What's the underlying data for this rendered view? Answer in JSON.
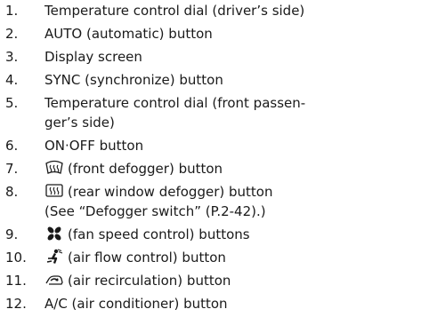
{
  "items": [
    {
      "num": "1.",
      "text": "Temperature control dial (driver’s side)"
    },
    {
      "num": "2.",
      "text": "AUTO (automatic) button"
    },
    {
      "num": "3.",
      "text": "Display screen"
    },
    {
      "num": "4.",
      "text": "SYNC (synchronize) button"
    },
    {
      "num": "5.",
      "text": "Temperature control dial (front passen-",
      "text2": "ger’s side)"
    },
    {
      "num": "6.",
      "text": "ON·OFF button"
    },
    {
      "num": "7.",
      "text": "(front defogger) button",
      "icon": "front-defogger-icon"
    },
    {
      "num": "8.",
      "text": "(rear window defogger) button",
      "icon": "rear-defogger-icon",
      "text2": "(See “Defogger switch” (P.2-42).)"
    },
    {
      "num": "9.",
      "text": "(fan speed control) buttons",
      "icon": "fan-icon"
    },
    {
      "num": "10.",
      "text": "(air flow control) button",
      "icon": "air-flow-icon"
    },
    {
      "num": "11.",
      "text": "(air recirculation) button",
      "icon": "air-recirculation-icon"
    },
    {
      "num": "12.",
      "text": "A/C (air conditioner) button"
    }
  ],
  "colors": {
    "text": "#1a1a1a"
  }
}
